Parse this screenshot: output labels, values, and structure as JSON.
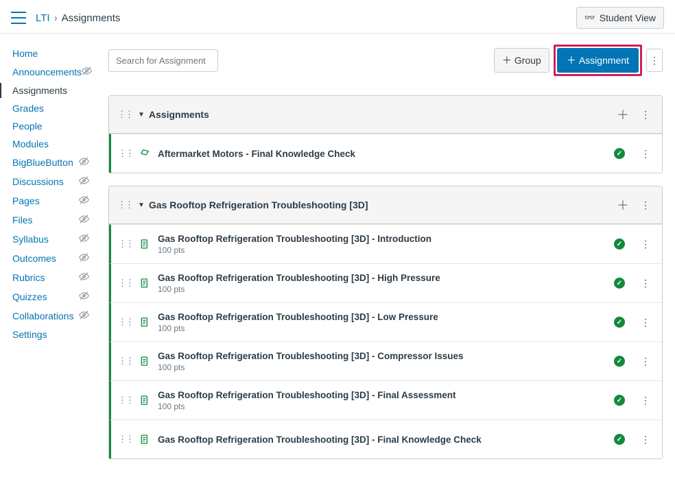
{
  "breadcrumb": {
    "course": "LTI",
    "page": "Assignments"
  },
  "buttons": {
    "student_view": "Student View",
    "group": "Group",
    "assignment": "Assignment"
  },
  "search": {
    "placeholder": "Search for Assignment"
  },
  "nav": [
    {
      "label": "Home",
      "hidden": false,
      "active": false
    },
    {
      "label": "Announcements",
      "hidden": true,
      "active": false
    },
    {
      "label": "Assignments",
      "hidden": false,
      "active": true
    },
    {
      "label": "Grades",
      "hidden": false,
      "active": false
    },
    {
      "label": "People",
      "hidden": false,
      "active": false
    },
    {
      "label": "Modules",
      "hidden": false,
      "active": false
    },
    {
      "label": "BigBlueButton",
      "hidden": true,
      "active": false
    },
    {
      "label": "Discussions",
      "hidden": true,
      "active": false
    },
    {
      "label": "Pages",
      "hidden": true,
      "active": false
    },
    {
      "label": "Files",
      "hidden": true,
      "active": false
    },
    {
      "label": "Syllabus",
      "hidden": true,
      "active": false
    },
    {
      "label": "Outcomes",
      "hidden": true,
      "active": false
    },
    {
      "label": "Rubrics",
      "hidden": true,
      "active": false
    },
    {
      "label": "Quizzes",
      "hidden": true,
      "active": false
    },
    {
      "label": "Collaborations",
      "hidden": true,
      "active": false
    },
    {
      "label": "Settings",
      "hidden": false,
      "active": false
    }
  ],
  "groups": [
    {
      "title": "Assignments",
      "items": [
        {
          "title": "Aftermarket Motors - Final Knowledge Check",
          "sub": "",
          "type": "quiz",
          "published": true
        }
      ]
    },
    {
      "title": "Gas Rooftop Refrigeration Troubleshooting [3D]",
      "items": [
        {
          "title": "Gas Rooftop Refrigeration Troubleshooting [3D] - Introduction",
          "sub": "100 pts",
          "type": "assignment",
          "published": true
        },
        {
          "title": "Gas Rooftop Refrigeration Troubleshooting [3D] - High Pressure",
          "sub": "100 pts",
          "type": "assignment",
          "published": true
        },
        {
          "title": "Gas Rooftop Refrigeration Troubleshooting [3D] - Low Pressure",
          "sub": "100 pts",
          "type": "assignment",
          "published": true
        },
        {
          "title": "Gas Rooftop Refrigeration Troubleshooting [3D] - Compressor Issues",
          "sub": "100 pts",
          "type": "assignment",
          "published": true
        },
        {
          "title": "Gas Rooftop Refrigeration Troubleshooting [3D] - Final Assessment",
          "sub": "100 pts",
          "type": "assignment",
          "published": true
        },
        {
          "title": "Gas Rooftop Refrigeration Troubleshooting [3D] - Final Knowledge Check",
          "sub": "",
          "type": "assignment",
          "published": true
        }
      ]
    }
  ]
}
